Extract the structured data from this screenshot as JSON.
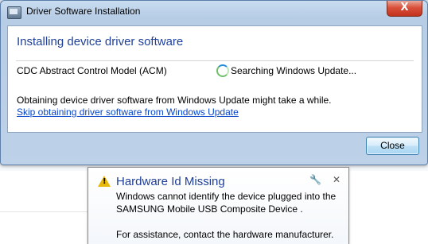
{
  "dialog": {
    "title": "Driver Software Installation",
    "close_glyph": "X",
    "heading": "Installing device driver software",
    "device_name": "CDC Abstract Control Model (ACM)",
    "status": "Searching Windows Update...",
    "info": "Obtaining device driver software from Windows Update might take a while.",
    "skip_link": "Skip obtaining driver software from Windows Update",
    "close_button": "Close"
  },
  "balloon": {
    "title": "Hardware Id Missing",
    "line1": "Windows cannot identify the device plugged into the",
    "line2": "SAMSUNG Mobile USB Composite Device .",
    "line3": "For assistance, contact the hardware manufacturer.",
    "settings_icon": "wrench-icon",
    "close_icon": "x-icon",
    "warning_icon": "warning-icon"
  },
  "colors": {
    "heading": "#1e3f9a",
    "link": "#0645c9",
    "warning": "#e8b90c"
  }
}
